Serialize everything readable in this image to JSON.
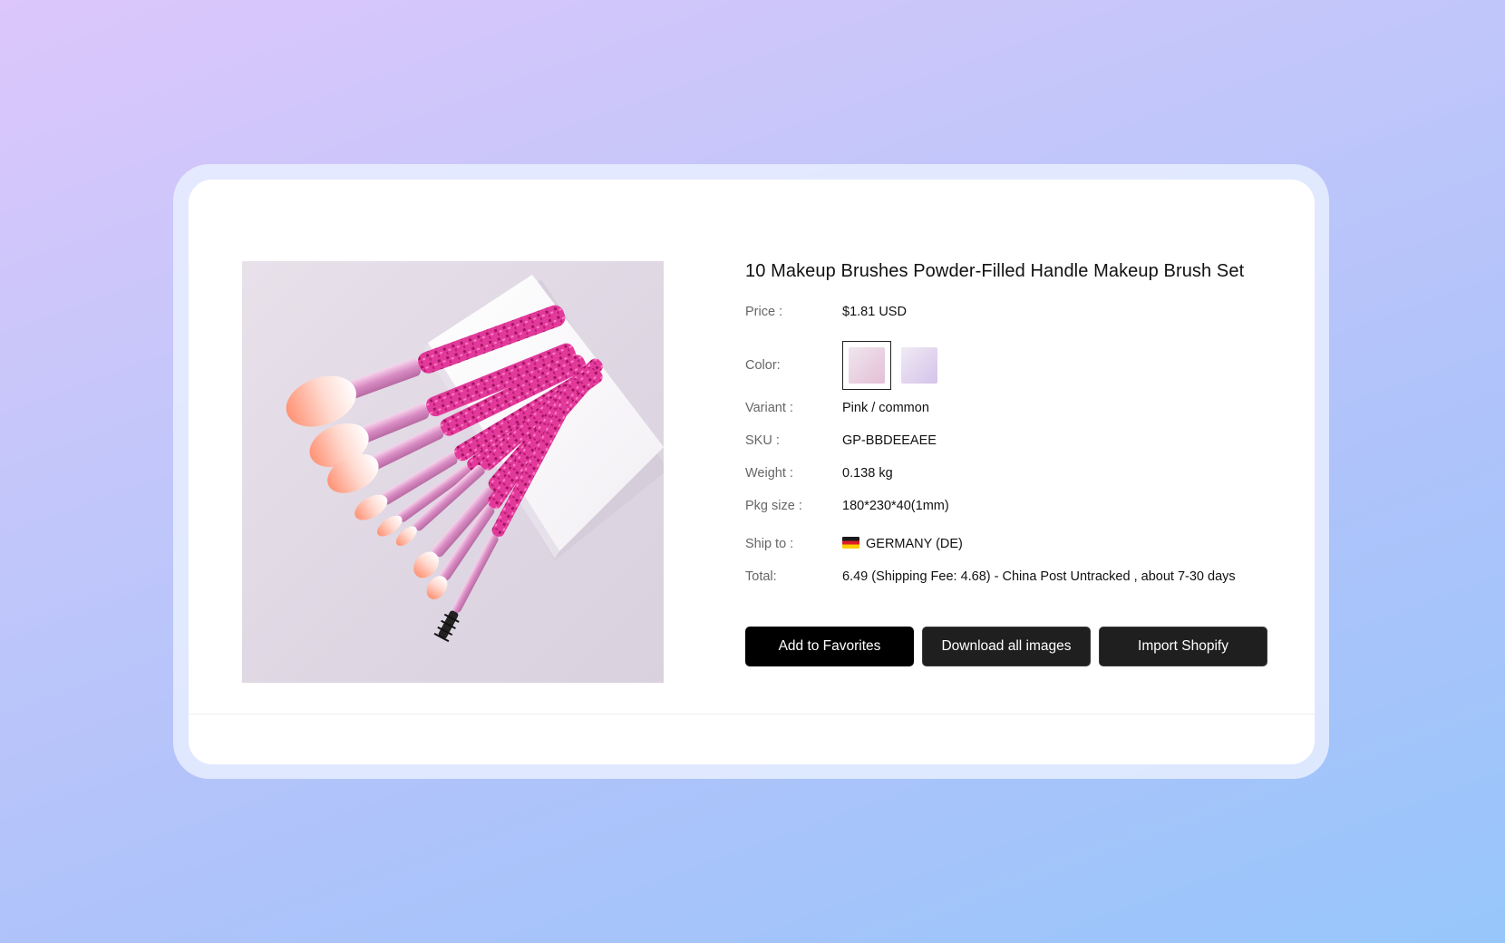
{
  "product": {
    "title": "10 Makeup Brushes Powder-Filled Handle Makeup Brush Set",
    "image_alt": "pink glitter makeup brush set on white block"
  },
  "fields": {
    "price": {
      "label": "Price :",
      "value": "$1.81 USD"
    },
    "color": {
      "label": "Color:",
      "options": [
        "pink",
        "purple"
      ],
      "selected": "pink"
    },
    "variant": {
      "label": "Variant :",
      "value": "Pink / common"
    },
    "sku": {
      "label": "SKU :",
      "value": "GP-BBDEEAEE"
    },
    "weight": {
      "label": "Weight :",
      "value": "0.138 kg"
    },
    "pkg_size": {
      "label": "Pkg size :",
      "value": "180*230*40(1mm)"
    },
    "ship_to": {
      "label": "Ship to :",
      "value": "GERMANY (DE)",
      "flag": "de-flag-icon"
    },
    "total": {
      "label": "Total:",
      "value": "6.49 (Shipping Fee: 4.68) - China Post Untracked , about 7-30 days"
    }
  },
  "buttons": {
    "favorites": "Add to Favorites",
    "download": "Download all images",
    "import": "Import Shopify"
  },
  "colors": {
    "background_start": "#dcc6fb",
    "background_end": "#97c6fb",
    "button_primary": "#000000",
    "button_dark": "#1f1f1f"
  }
}
